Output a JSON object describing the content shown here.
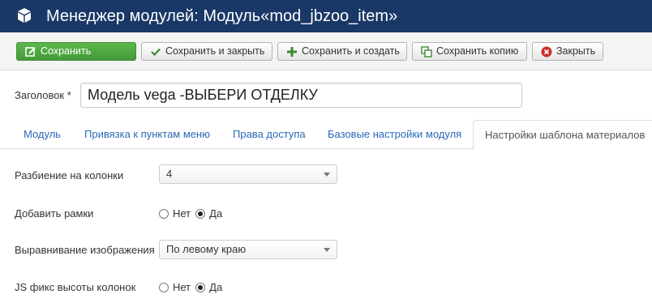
{
  "header": {
    "title": "Менеджер модулей: Модуль«mod_jbzoo_item»",
    "logo_icon": "joomla-cube-icon"
  },
  "toolbar": {
    "save_label": "Сохранить",
    "save_close_label": "Сохранить и закрыть",
    "save_new_label": "Сохранить и создать",
    "save_copy_label": "Сохранить копию",
    "close_label": "Закрыть"
  },
  "form": {
    "title_label": "Заголовок *",
    "title_value": "Модель vega -ВЫБЕРИ ОТДЕЛКУ"
  },
  "tabs": [
    {
      "label": "Модуль",
      "active": false
    },
    {
      "label": "Привязка к пунктам меню",
      "active": false
    },
    {
      "label": "Права доступа",
      "active": false
    },
    {
      "label": "Базовые настройки модуля",
      "active": false
    },
    {
      "label": "Настройки шаблона материалов",
      "active": true
    }
  ],
  "settings": {
    "columns": {
      "label": "Разбиение на колонки",
      "value": "4"
    },
    "borders": {
      "label": "Добавить рамки",
      "options": [
        "Нет",
        "Да"
      ],
      "selected": "Да"
    },
    "image_align": {
      "label": "Выравнивание изображения",
      "value": "По левому краю"
    },
    "js_height": {
      "label": "JS фикс высоты колонок",
      "options": [
        "Нет",
        "Да"
      ],
      "selected": "Да"
    }
  },
  "colors": {
    "header_bg": "#1a3867",
    "save_button": "#46a036",
    "link": "#2a69b8",
    "close_icon": "#c9302c"
  }
}
